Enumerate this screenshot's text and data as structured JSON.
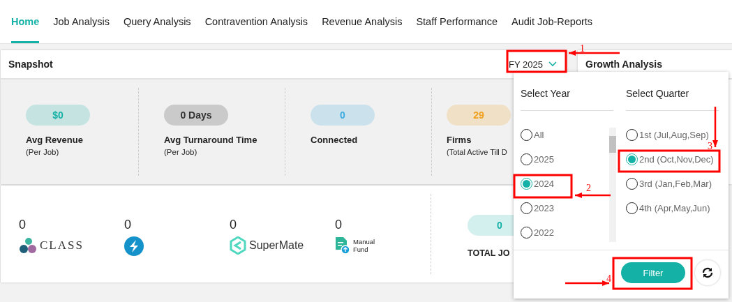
{
  "tabs": [
    {
      "label": "Home",
      "selected": true
    },
    {
      "label": "Job Analysis",
      "selected": false
    },
    {
      "label": "Query Analysis",
      "selected": false
    },
    {
      "label": "Contravention Analysis",
      "selected": false
    },
    {
      "label": "Revenue Analysis",
      "selected": false
    },
    {
      "label": "Staff Performance",
      "selected": false
    },
    {
      "label": "Audit Job-Reports",
      "selected": false
    }
  ],
  "snapshot": {
    "title": "Snapshot",
    "period_select": "FY 2025",
    "stats": [
      {
        "value": "$0",
        "label": "Avg Revenue",
        "sublabel": "(Per Job)",
        "color": "#14b1a6"
      },
      {
        "value": "0 Days",
        "label": "Avg Turnaround Time",
        "sublabel": "(Per Job)",
        "color": "#333333"
      },
      {
        "value": "0",
        "label": "Connected",
        "color": "#39a9e0"
      },
      {
        "value": "29",
        "label": "Firms",
        "sublabel": "(Total Active Till D",
        "color": "#f0a01e"
      }
    ]
  },
  "sources": {
    "items": [
      {
        "count": "0",
        "kind": "class",
        "name": "CLASS"
      },
      {
        "count": "0",
        "kind": "circle"
      },
      {
        "count": "0",
        "kind": "supermate",
        "name": "SuperMate"
      },
      {
        "count": "0",
        "kind": "manual",
        "name": "Manual Fund"
      }
    ],
    "total": {
      "value": "0",
      "label": "TOTAL JO"
    }
  },
  "growth_analysis": {
    "title": "Growth Analysis"
  },
  "filter_popup": {
    "year_heading": "Select Year",
    "quarter_heading": "Select Quarter",
    "years": [
      {
        "label": "All",
        "selected": false
      },
      {
        "label": "2025",
        "selected": false
      },
      {
        "label": "2024",
        "selected": true
      },
      {
        "label": "2023",
        "selected": false
      },
      {
        "label": "2022",
        "selected": false
      }
    ],
    "quarters": [
      {
        "label": "1st (Jul,Aug,Sep)",
        "selected": false
      },
      {
        "label": "2nd (Oct,Nov,Dec)",
        "selected": true
      },
      {
        "label": "3rd (Jan,Feb,Mar)",
        "selected": false
      },
      {
        "label": "4th (Apr,May,Jun)",
        "selected": false
      }
    ],
    "filter_button": "Filter"
  },
  "annotations": [
    {
      "label": "1"
    },
    {
      "label": "2"
    },
    {
      "label": "3"
    },
    {
      "label": "4"
    }
  ]
}
